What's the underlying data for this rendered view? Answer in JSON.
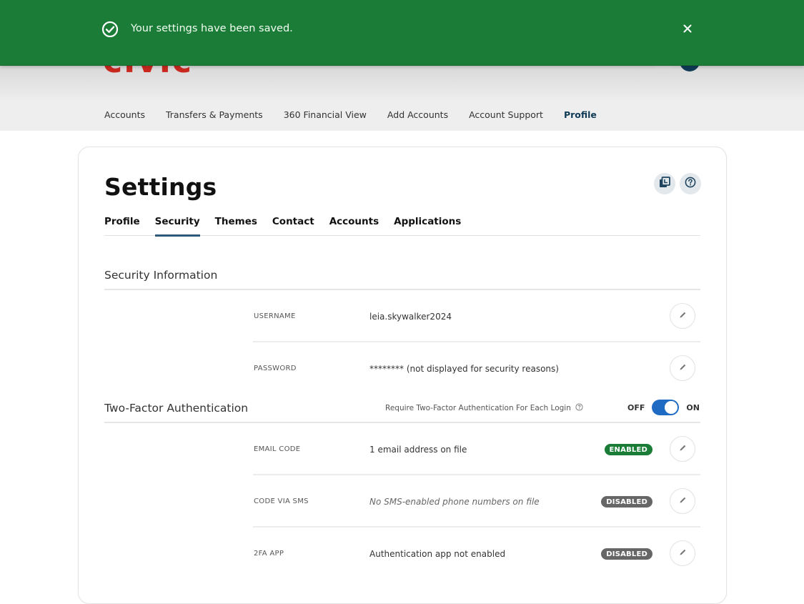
{
  "toast": {
    "message": "Your settings have been saved.",
    "icon": "check-circle-icon",
    "close_icon": "close-icon",
    "color": "#1b7c37"
  },
  "header": {
    "logo_text": "civic",
    "logo_color": "#c8281e"
  },
  "nav": {
    "items": [
      {
        "label": "Accounts"
      },
      {
        "label": "Transfers & Payments"
      },
      {
        "label": "360 Financial View"
      },
      {
        "label": "Add Accounts"
      },
      {
        "label": "Account Support"
      },
      {
        "label": "Profile",
        "active": true
      }
    ]
  },
  "settings": {
    "title": "Settings",
    "header_icons": [
      "statements-icon",
      "help-icon"
    ],
    "tabs": [
      {
        "label": "Profile"
      },
      {
        "label": "Security",
        "active": true
      },
      {
        "label": "Themes"
      },
      {
        "label": "Contact"
      },
      {
        "label": "Accounts"
      },
      {
        "label": "Applications"
      }
    ],
    "security_info": {
      "title": "Security Information",
      "rows": [
        {
          "label": "USERNAME",
          "value": "leia.skywalker2024"
        },
        {
          "label": "PASSWORD",
          "value": "******** (not displayed for security reasons)"
        }
      ]
    },
    "two_factor": {
      "title": "Two-Factor Authentication",
      "require_label": "Require Two-Factor Authentication For Each Login",
      "toggle": {
        "off_label": "OFF",
        "on_label": "ON",
        "state": "on"
      },
      "rows": [
        {
          "label": "EMAIL CODE",
          "value": "1 email address on file",
          "status": "ENABLED",
          "status_color": "#1b7c37"
        },
        {
          "label": "CODE VIA SMS",
          "value": "No SMS-enabled phone numbers on file",
          "status": "DISABLED",
          "status_color": "#666666"
        },
        {
          "label": "2FA APP",
          "value": "Authentication app not enabled",
          "status": "DISABLED",
          "status_color": "#666666"
        }
      ]
    }
  }
}
